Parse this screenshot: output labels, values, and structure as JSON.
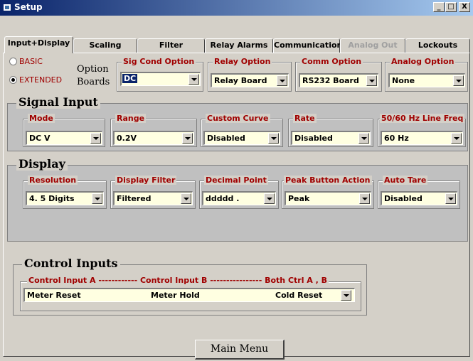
{
  "window": {
    "title": "Setup",
    "minimize": "_",
    "maximize": "□",
    "close": "X"
  },
  "tabs": [
    {
      "label": "Input+Display",
      "active": true
    },
    {
      "label": "Scaling"
    },
    {
      "label": "Filter"
    },
    {
      "label": "Relay Alarms"
    },
    {
      "label": "Communication"
    },
    {
      "label": "Analog Out",
      "disabled": true
    },
    {
      "label": "Lockouts"
    }
  ],
  "mode_select": {
    "basic": "BASIC",
    "extended": "EXTENDED",
    "selected": "EXTENDED"
  },
  "option_boards": {
    "label_line1": "Option",
    "label_line2": "Boards",
    "sig_cond": {
      "label": "Sig Cond Option",
      "value": "DC"
    },
    "relay": {
      "label": "Relay Option",
      "value": "Relay Board"
    },
    "comm": {
      "label": "Comm Option",
      "value": "RS232 Board"
    },
    "analog": {
      "label": "Analog Option",
      "value": "None"
    }
  },
  "signal_input": {
    "title": "Signal Input",
    "mode": {
      "label": "Mode",
      "value": "DC V"
    },
    "range": {
      "label": "Range",
      "value": "0.2V"
    },
    "custom_curve": {
      "label": "Custom Curve",
      "value": "Disabled"
    },
    "rate": {
      "label": "Rate",
      "value": "Disabled"
    },
    "line_freq": {
      "label": "50/60 Hz Line Freq",
      "value": "60 Hz"
    }
  },
  "display": {
    "title": "Display",
    "resolution": {
      "label": "Resolution",
      "value": "4. 5 Digits"
    },
    "display_filter": {
      "label": "Display Filter",
      "value": "Filtered"
    },
    "decimal_point": {
      "label": "Decimal Point",
      "value": "ddddd ."
    },
    "peak_button": {
      "label": "Peak Button Action",
      "value": "Peak"
    },
    "auto_tare": {
      "label": "Auto Tare",
      "value": "Disabled"
    }
  },
  "control_inputs": {
    "title": "Control Inputs",
    "header": "Control Input A ------------ Control Input B ---------------- Both Ctrl A , B",
    "value_a": "Meter Reset",
    "value_b": "Meter Hold",
    "value_both": "Cold Reset"
  },
  "main_menu_label": "Main Menu"
}
